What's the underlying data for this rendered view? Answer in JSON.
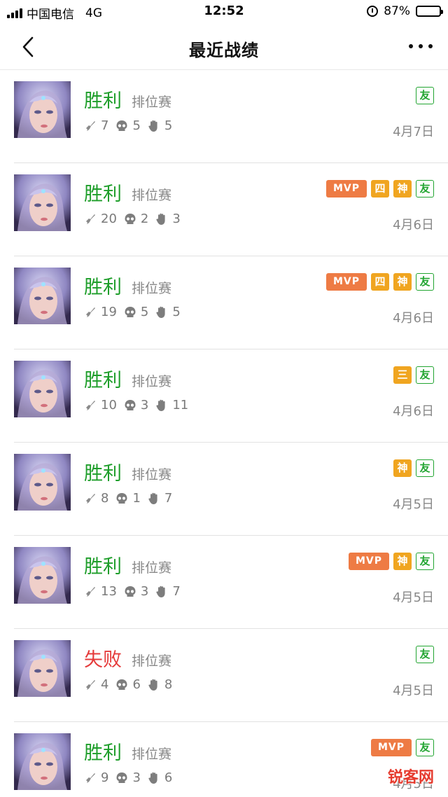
{
  "status_bar": {
    "carrier": "中国电信",
    "network": "4G",
    "time": "12:52",
    "battery": "87%",
    "battery_level": 0.87
  },
  "nav": {
    "title": "最近战绩"
  },
  "icons": {
    "kills": "sword-icon",
    "deaths": "skull-icon",
    "assists": "hand-icon"
  },
  "colors": {
    "win": "#1e9e2a",
    "lose": "#e53a3a",
    "mvp": "#ee7b44",
    "tag": "#f0a520",
    "friend": "#22a531"
  },
  "matches": [
    {
      "result": "胜利",
      "outcome": "win",
      "mode": "排位赛",
      "kills": "7",
      "deaths": "5",
      "assists": "5",
      "date": "4月7日",
      "badges": [
        {
          "type": "you",
          "label": "友"
        }
      ]
    },
    {
      "result": "胜利",
      "outcome": "win",
      "mode": "排位赛",
      "kills": "20",
      "deaths": "2",
      "assists": "3",
      "date": "4月6日",
      "badges": [
        {
          "type": "mvp",
          "label": "MVP"
        },
        {
          "type": "si",
          "label": "四"
        },
        {
          "type": "shen",
          "label": "神"
        },
        {
          "type": "you",
          "label": "友"
        }
      ]
    },
    {
      "result": "胜利",
      "outcome": "win",
      "mode": "排位赛",
      "kills": "19",
      "deaths": "5",
      "assists": "5",
      "date": "4月6日",
      "badges": [
        {
          "type": "mvp",
          "label": "MVP"
        },
        {
          "type": "si",
          "label": "四"
        },
        {
          "type": "shen",
          "label": "神"
        },
        {
          "type": "you",
          "label": "友"
        }
      ]
    },
    {
      "result": "胜利",
      "outcome": "win",
      "mode": "排位赛",
      "kills": "10",
      "deaths": "3",
      "assists": "11",
      "date": "4月6日",
      "badges": [
        {
          "type": "san",
          "label": "三"
        },
        {
          "type": "you",
          "label": "友"
        }
      ]
    },
    {
      "result": "胜利",
      "outcome": "win",
      "mode": "排位赛",
      "kills": "8",
      "deaths": "1",
      "assists": "7",
      "date": "4月5日",
      "badges": [
        {
          "type": "shen",
          "label": "神"
        },
        {
          "type": "you",
          "label": "友"
        }
      ]
    },
    {
      "result": "胜利",
      "outcome": "win",
      "mode": "排位赛",
      "kills": "13",
      "deaths": "3",
      "assists": "7",
      "date": "4月5日",
      "badges": [
        {
          "type": "mvp",
          "label": "MVP"
        },
        {
          "type": "shen",
          "label": "神"
        },
        {
          "type": "you",
          "label": "友"
        }
      ]
    },
    {
      "result": "失败",
      "outcome": "lose",
      "mode": "排位赛",
      "kills": "4",
      "deaths": "6",
      "assists": "8",
      "date": "4月5日",
      "badges": [
        {
          "type": "you",
          "label": "友"
        }
      ]
    },
    {
      "result": "胜利",
      "outcome": "win",
      "mode": "排位赛",
      "kills": "9",
      "deaths": "3",
      "assists": "6",
      "date": "4月5日",
      "badges": [
        {
          "type": "mvp",
          "label": "MVP"
        },
        {
          "type": "you",
          "label": "友"
        }
      ]
    }
  ],
  "watermark": "锐客网"
}
